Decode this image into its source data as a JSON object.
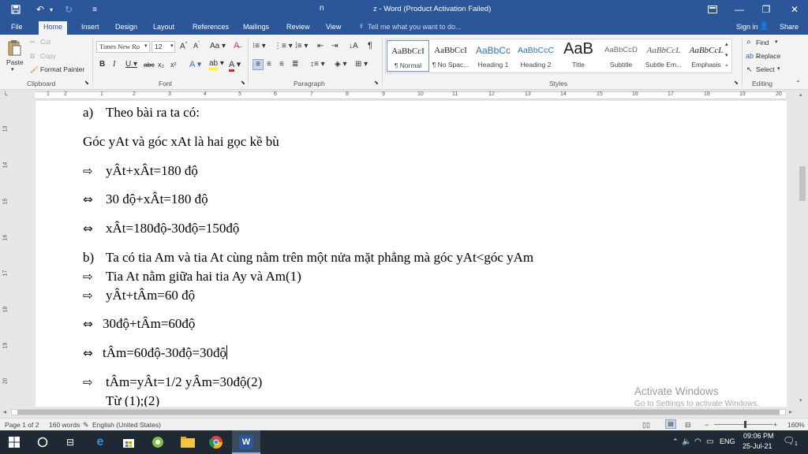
{
  "titlebar": {
    "doc_short": "n",
    "title": "z - Word (Product Activation Failed)",
    "undo_icon": "undo-icon",
    "redo_icon": "redo-icon"
  },
  "tabs": [
    "File",
    "Home",
    "Insert",
    "Design",
    "Layout",
    "References",
    "Mailings",
    "Review",
    "View"
  ],
  "tell_me": "Tell me what you want to do...",
  "sign_in": "Sign in",
  "share": "Share",
  "ribbon": {
    "clipboard": {
      "paste": "Paste",
      "cut": "Cut",
      "copy": "Copy",
      "format_painter": "Format Painter",
      "label": "Clipboard"
    },
    "font": {
      "name": "Times New Ro",
      "size": "12",
      "label": "Font"
    },
    "paragraph": {
      "label": "Paragraph"
    },
    "styles": {
      "label": "Styles",
      "items": [
        {
          "preview": "AaBbCcI",
          "name": "¶ Normal"
        },
        {
          "preview": "AaBbCcI",
          "name": "¶ No Spac..."
        },
        {
          "preview": "AaBbCc",
          "name": "Heading 1"
        },
        {
          "preview": "AaBbCcC",
          "name": "Heading 2"
        },
        {
          "preview": "AaB",
          "name": "Title"
        },
        {
          "preview": "AaBbCcD",
          "name": "Subtitle"
        },
        {
          "preview": "AaBbCcL",
          "name": "Subtle Em..."
        },
        {
          "preview": "AaBbCcL",
          "name": "Emphasis"
        }
      ]
    },
    "editing": {
      "find": "Find",
      "replace": "Replace",
      "select": "Select",
      "label": "Editing"
    }
  },
  "ruler_numbers": [
    "1",
    "2",
    "1",
    "2",
    "3",
    "4",
    "5",
    "6",
    "7",
    "8",
    "9",
    "10",
    "11",
    "12",
    "13",
    "14",
    "15",
    "16",
    "17",
    "18",
    "19",
    "20"
  ],
  "vruler_numbers": [
    "13",
    "14",
    "15",
    "16",
    "17",
    "18",
    "19",
    "20"
  ],
  "document": {
    "lines": [
      {
        "marker": "a)",
        "text": "Theo bài ra ta có:"
      },
      {
        "marker": "",
        "text": "Góc yAt và góc xAt là hai gọc kề bù"
      },
      {
        "marker": "⇨",
        "text": "yÂt+xÂt=180 độ"
      },
      {
        "marker": "⇔",
        "text": "30 độ+xÂt=180 độ"
      },
      {
        "marker": "⇔",
        "text": "xÂt=180độ-30độ=150độ"
      },
      {
        "marker": "b)",
        "text": "Ta có tia Am và tia At cùng nằm trên một nửa mặt phẳng mà góc yAt<góc yAm"
      },
      {
        "marker": "⇨",
        "text": "Tia At nằm giữa hai tia Ay và Am(1)"
      },
      {
        "marker": "⇨",
        "text": "yÂt+tÂm=60 độ"
      },
      {
        "marker": "⇔",
        "text": "30độ+tÂm=60độ"
      },
      {
        "marker": "⇔",
        "text": "tÂm=60độ-30độ=30độ"
      },
      {
        "marker": "⇨",
        "text": "tÂm=yÂt=1/2 yÂm=30độ(2)"
      },
      {
        "marker": "",
        "text": "Từ (1);(2)"
      }
    ]
  },
  "watermark": {
    "line1": "Activate Windows",
    "line2": "Go to Settings to activate Windows."
  },
  "status": {
    "page": "Page 1 of 2",
    "words": "160 words",
    "language": "English (United States)",
    "zoom": "160%"
  },
  "taskbar": {
    "lang": "ENG",
    "time": "09:06 PM",
    "date": "25-Jul-21",
    "notif_count": "1"
  }
}
